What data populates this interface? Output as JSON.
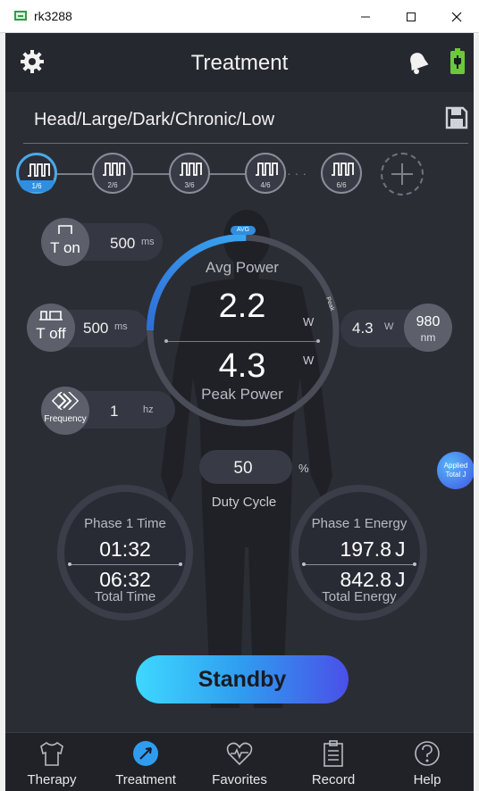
{
  "window": {
    "title": "rk3288"
  },
  "header": {
    "title": "Treatment",
    "gear_icon": "gear-icon",
    "bell_icon": "bell-icon",
    "battery_icon": "battery-charging-icon",
    "battery_color": "#6cc83a"
  },
  "preset": {
    "text": "Head/Large/Dark/Chronic/Low",
    "save_icon": "save-icon"
  },
  "phases": [
    {
      "label": "1/6",
      "active": true
    },
    {
      "label": "2/6",
      "active": false
    },
    {
      "label": "3/6",
      "active": false
    },
    {
      "label": "4/6",
      "active": false
    },
    {
      "label": "6/6",
      "active": false
    }
  ],
  "phase_ellipsis": "···",
  "controls": {
    "t_on": {
      "label": "T on",
      "value": "500",
      "unit": "ms"
    },
    "t_off": {
      "label": "T off",
      "value": "500",
      "unit": "ms"
    },
    "frequency": {
      "label": "Frequency",
      "value": "1",
      "unit": "hz"
    },
    "wavelength": {
      "value": "980",
      "unit": "nm"
    },
    "peak_side": {
      "value": "4.3",
      "unit": "W"
    }
  },
  "gauge": {
    "avg_tag": "AVG",
    "peak_tag": "Peak",
    "avg_label": "Avg Power",
    "avg_value": "2.2",
    "avg_unit": "W",
    "peak_value": "4.3",
    "peak_unit": "W",
    "peak_label": "Peak Power",
    "avg_fraction": 0.51,
    "accent": "#2f8ee0"
  },
  "duty": {
    "value": "50",
    "unit": "%",
    "label": "Duty Cycle"
  },
  "time_ring": {
    "phase_label": "Phase 1 Time",
    "phase_value": "01:32",
    "total_value": "06:32",
    "total_label": "Total Time"
  },
  "energy_ring": {
    "phase_label": "Phase 1 Energy",
    "phase_value": "197.8",
    "phase_unit": "J",
    "total_value": "842.8",
    "total_unit": "J",
    "total_label": "Total Energy"
  },
  "applied": {
    "line1": "Applied",
    "line2": "Total J"
  },
  "standby": {
    "label": "Standby"
  },
  "nav": [
    {
      "label": "Therapy",
      "icon": "shirt-icon"
    },
    {
      "label": "Treatment",
      "icon": "treatment-icon",
      "active": true
    },
    {
      "label": "Favorites",
      "icon": "heart-pulse-icon"
    },
    {
      "label": "Record",
      "icon": "clipboard-icon"
    },
    {
      "label": "Help",
      "icon": "help-icon"
    }
  ]
}
